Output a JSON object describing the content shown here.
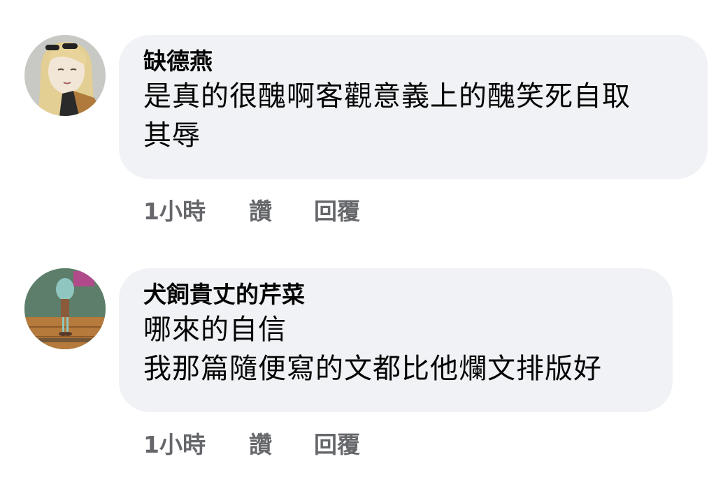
{
  "comments": [
    {
      "author": "缺德燕",
      "lines": [
        "是真的很醜啊客觀意義上的醜笑死自取",
        "其辱"
      ],
      "time": "1小時",
      "like_label": "讚",
      "reply_label": "回覆",
      "avatar_icon": "user-avatar-blonde-illustration"
    },
    {
      "author": "犬飼貴丈的芹菜",
      "lines": [
        "哪來的自信",
        "我那篇隨便寫的文都比他爛文排版好"
      ],
      "time": "1小時",
      "like_label": "讚",
      "reply_label": "回覆",
      "avatar_icon": "user-avatar-squidward-cartoon"
    }
  ],
  "colors": {
    "bubble_bg": "#f0f2f5",
    "text": "#050505",
    "meta": "#65676b"
  }
}
